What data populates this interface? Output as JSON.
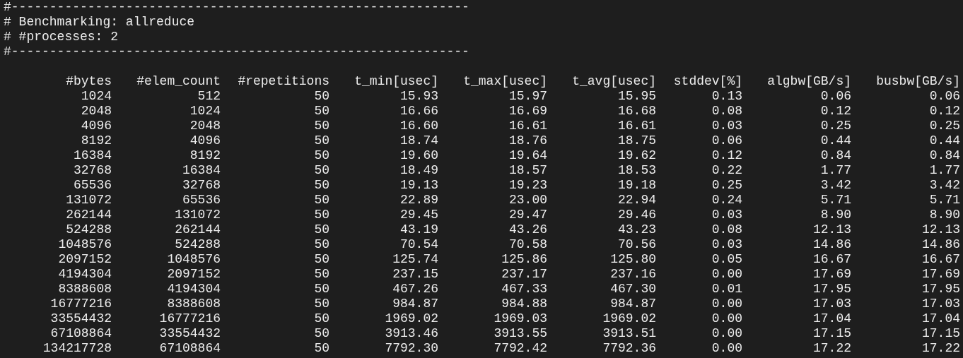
{
  "header_lines": [
    "#------------------------------------------------------------",
    "# Benchmarking: allreduce",
    "# #processes: 2",
    "#------------------------------------------------------------"
  ],
  "table": {
    "columns": [
      "#bytes",
      "#elem_count",
      "#repetitions",
      "t_min[usec]",
      "t_max[usec]",
      "t_avg[usec]",
      "stddev[%]",
      "algbw[GB/s]",
      "busbw[GB/s]"
    ],
    "rows": [
      [
        "1024",
        "512",
        "50",
        "15.93",
        "15.97",
        "15.95",
        "0.13",
        "0.06",
        "0.06"
      ],
      [
        "2048",
        "1024",
        "50",
        "16.66",
        "16.69",
        "16.68",
        "0.08",
        "0.12",
        "0.12"
      ],
      [
        "4096",
        "2048",
        "50",
        "16.60",
        "16.61",
        "16.61",
        "0.03",
        "0.25",
        "0.25"
      ],
      [
        "8192",
        "4096",
        "50",
        "18.74",
        "18.76",
        "18.75",
        "0.06",
        "0.44",
        "0.44"
      ],
      [
        "16384",
        "8192",
        "50",
        "19.60",
        "19.64",
        "19.62",
        "0.12",
        "0.84",
        "0.84"
      ],
      [
        "32768",
        "16384",
        "50",
        "18.49",
        "18.57",
        "18.53",
        "0.22",
        "1.77",
        "1.77"
      ],
      [
        "65536",
        "32768",
        "50",
        "19.13",
        "19.23",
        "19.18",
        "0.25",
        "3.42",
        "3.42"
      ],
      [
        "131072",
        "65536",
        "50",
        "22.89",
        "23.00",
        "22.94",
        "0.24",
        "5.71",
        "5.71"
      ],
      [
        "262144",
        "131072",
        "50",
        "29.45",
        "29.47",
        "29.46",
        "0.03",
        "8.90",
        "8.90"
      ],
      [
        "524288",
        "262144",
        "50",
        "43.19",
        "43.26",
        "43.23",
        "0.08",
        "12.13",
        "12.13"
      ],
      [
        "1048576",
        "524288",
        "50",
        "70.54",
        "70.58",
        "70.56",
        "0.03",
        "14.86",
        "14.86"
      ],
      [
        "2097152",
        "1048576",
        "50",
        "125.74",
        "125.86",
        "125.80",
        "0.05",
        "16.67",
        "16.67"
      ],
      [
        "4194304",
        "2097152",
        "50",
        "237.15",
        "237.17",
        "237.16",
        "0.00",
        "17.69",
        "17.69"
      ],
      [
        "8388608",
        "4194304",
        "50",
        "467.26",
        "467.33",
        "467.30",
        "0.01",
        "17.95",
        "17.95"
      ],
      [
        "16777216",
        "8388608",
        "50",
        "984.87",
        "984.88",
        "984.87",
        "0.00",
        "17.03",
        "17.03"
      ],
      [
        "33554432",
        "16777216",
        "50",
        "1969.02",
        "1969.03",
        "1969.02",
        "0.00",
        "17.04",
        "17.04"
      ],
      [
        "67108864",
        "33554432",
        "50",
        "3913.46",
        "3913.55",
        "3913.51",
        "0.00",
        "17.15",
        "17.15"
      ],
      [
        "134217728",
        "67108864",
        "50",
        "7792.30",
        "7792.42",
        "7792.36",
        "0.00",
        "17.22",
        "17.22"
      ]
    ]
  }
}
